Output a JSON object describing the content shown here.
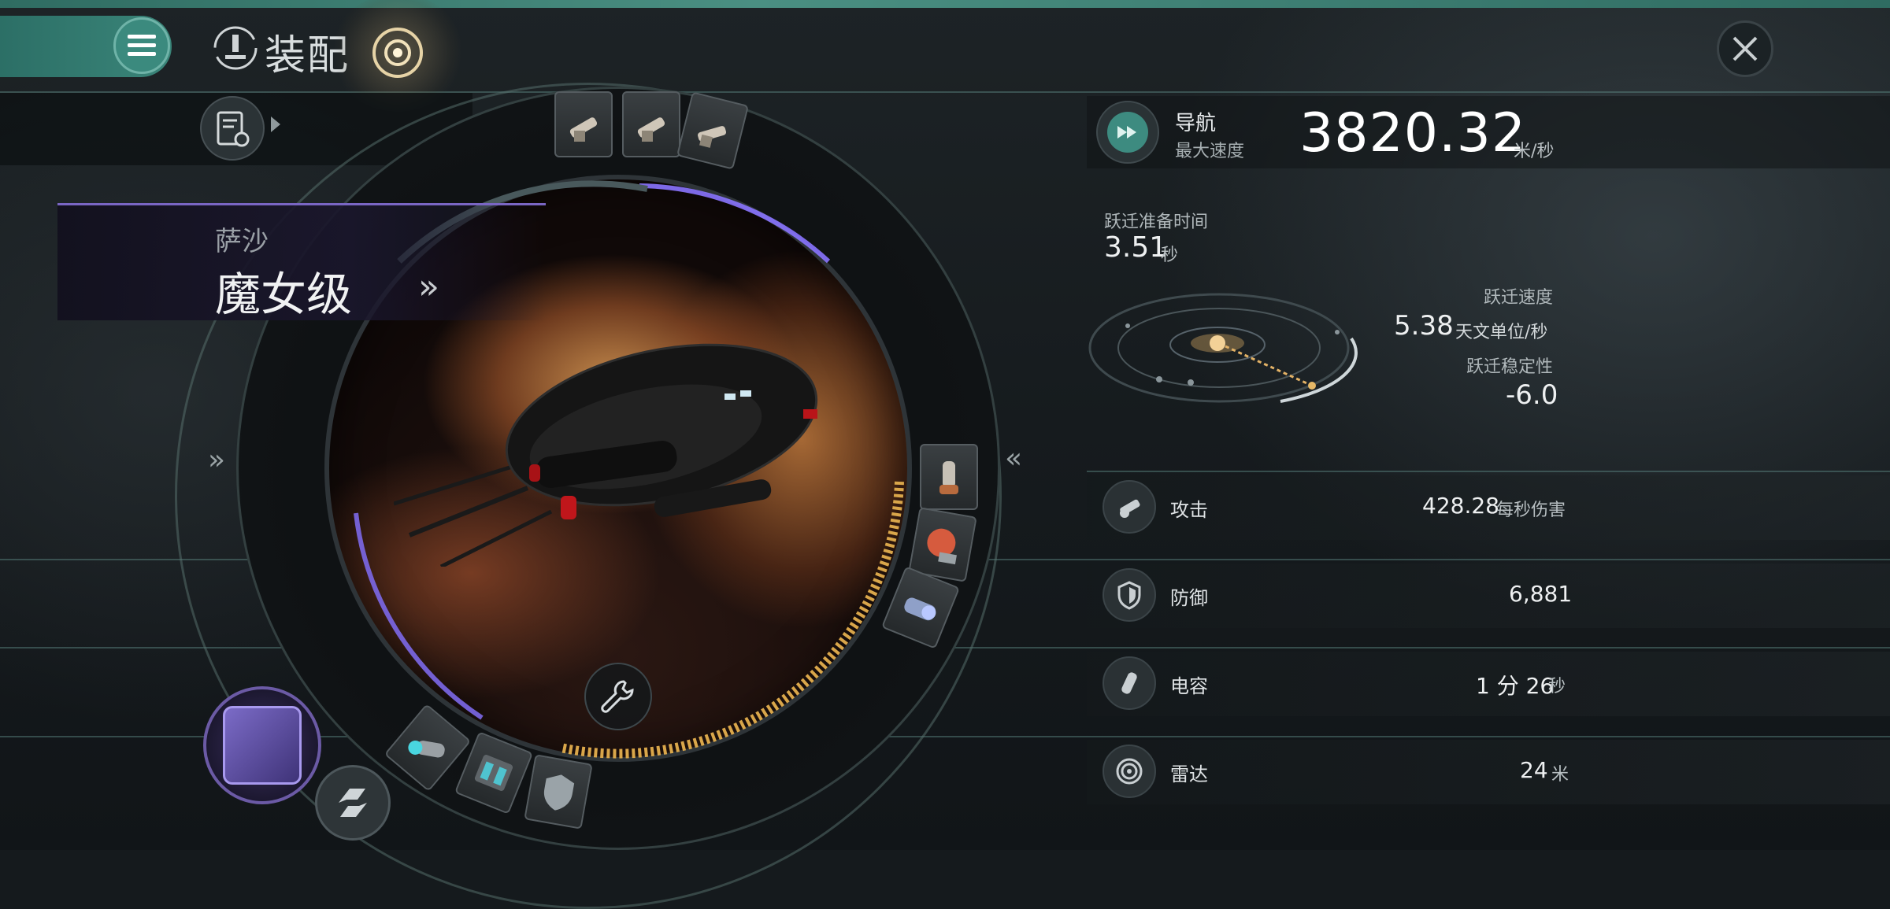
{
  "header": {
    "title": "装配",
    "menu_icon": "hamburger-icon",
    "title_icon": "fitting-icon",
    "close_icon": "close-icon"
  },
  "ship": {
    "faction": "萨沙",
    "name": "魔女级",
    "chevron": "»"
  },
  "side_arrows": {
    "left": "»",
    "right": "«"
  },
  "navigation": {
    "label": "导航",
    "sublabel": "最大速度",
    "max_speed": "3820.32",
    "speed_unit": "米/秒"
  },
  "warp": {
    "prep_label": "跃迁准备时间",
    "prep_value": "3.51",
    "prep_unit": "秒",
    "speed_label": "跃迁速度",
    "speed_value": "5.38",
    "speed_unit": "天文单位/秒",
    "stability_label": "跃迁稳定性",
    "stability_value": "-6.0"
  },
  "stats": [
    {
      "icon": "turret-icon",
      "label": "攻击",
      "value": "428.28",
      "unit": "每秒伤害"
    },
    {
      "icon": "shield-icon",
      "label": "防御",
      "value": "6,881",
      "unit": ""
    },
    {
      "icon": "capacitor-icon",
      "label": "电容",
      "value": "1 分 26",
      "unit": "秒"
    },
    {
      "icon": "radar-icon",
      "label": "雷达",
      "value": "24",
      "unit": "米"
    }
  ],
  "colors": {
    "accent_teal": "#3b8a7e",
    "ship_purple": "#7a66c4",
    "capacitor_gold": "#d9a64a"
  }
}
